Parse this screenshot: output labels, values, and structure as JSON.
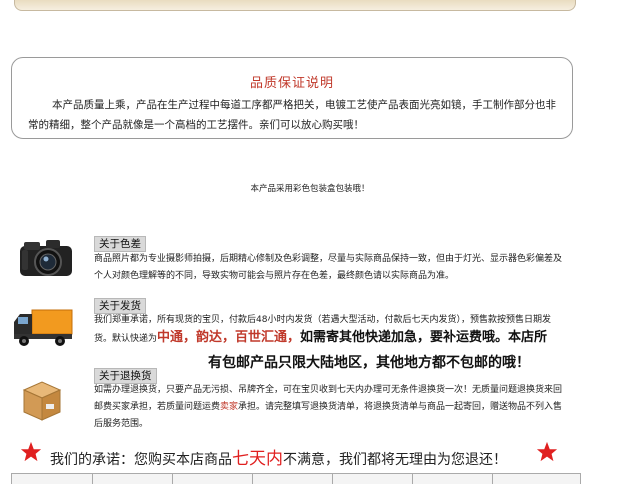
{
  "quality": {
    "title": "品质保证说明",
    "body": "本产品质量上乘，产品在生产过程中每道工序都严格把关，电镀工艺使产品表面光亮如镜，手工制作部分也非常的精细，整个产品就像是一个高档的工艺摆件。亲们可以放心购买哦！"
  },
  "pack_note": "本产品采用彩色包装盒包装哦！",
  "sections": {
    "color": {
      "label": "关于色差",
      "text": "商品照片都为专业摄影师拍摄，后期精心修制及色彩调整，尽量与实际商品保持一致，但由于灯光、显示器色彩偏差及个人对颜色理解等的不同，导致实物可能会与照片存在色差，最终颜色请以实际商品为准。",
      "icon": "camera-icon"
    },
    "shipping": {
      "label": "关于发货",
      "text_prefix": "我们郑重承诺，所有现货的宝贝，付款后48小时内发货（若遇大型活动，付款后七天内发货），预售款按预售日期发货。默认快递为",
      "text_red": "中通，韵达，百世汇通，",
      "text_suffix": "如需寄其他快递加急，要补运费哦。本店所",
      "notice": "有包邮产品只限大陆地区，其他地方都不包邮的哦！",
      "icon": "truck-icon"
    },
    "returns": {
      "label": "关于退换货",
      "text_prefix": "如需办理退换货，只要产品无污损、吊牌齐全，可在宝贝收到七天内办理可无条件退换货一次！无质量问题退换货来回邮费买家承担，若质量问题运费",
      "text_red": "卖家",
      "text_suffix": "承担。请完整填写退换货清单，将退换货清单与商品一起寄回，赠送物品不列入售后服务范围。",
      "icon": "box-icon"
    }
  },
  "promise": {
    "prefix": "我们的承诺：您购买本店商品",
    "highlight": "七天内",
    "suffix": "不满意，我们都将无理由为您退还！"
  },
  "colors": {
    "accent_red": "#c0392b",
    "bright_red": "#e02020",
    "label_bg": "#d9d9d9"
  }
}
